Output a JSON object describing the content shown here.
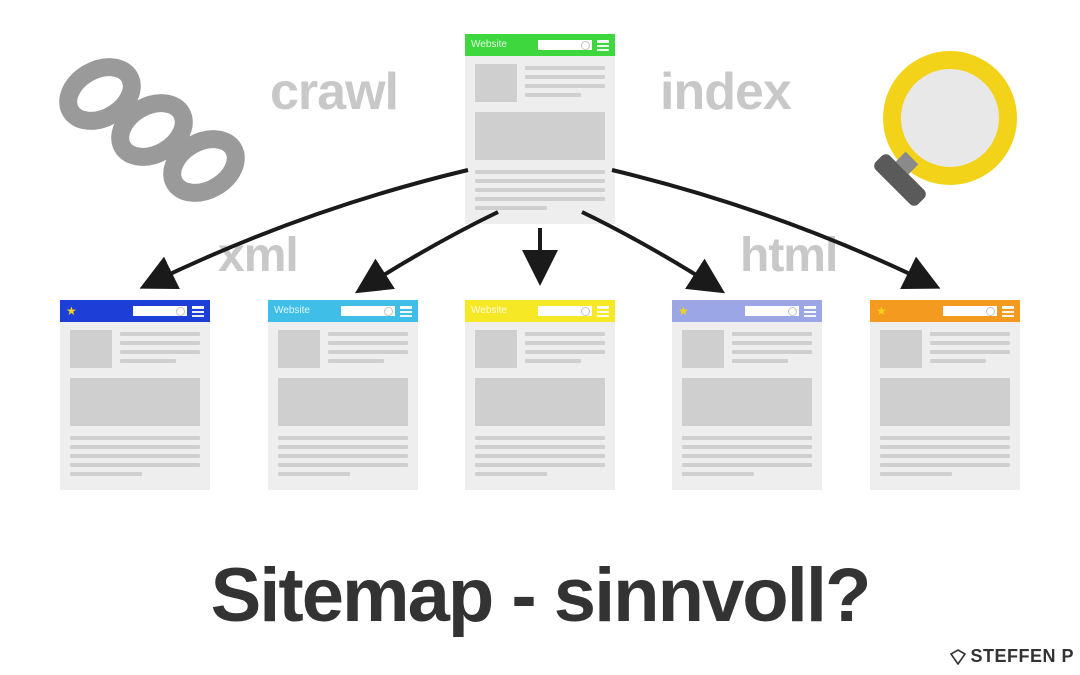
{
  "title": "Sitemap - sinnvoll?",
  "labels": {
    "crawl": "crawl",
    "index": "index",
    "xml": "xml",
    "html": "html"
  },
  "topCard": {
    "header_color": "#3ed83e",
    "label": "Website",
    "star": false
  },
  "bottomCards": [
    {
      "header_color": "#1e3ed8",
      "label": "",
      "star": true
    },
    {
      "header_color": "#3fbfe8",
      "label": "Website",
      "star": false
    },
    {
      "header_color": "#f7e826",
      "label": "Website",
      "star": false
    },
    {
      "header_color": "#9aa6e6",
      "label": "",
      "star": true
    },
    {
      "header_color": "#f39a1f",
      "label": "",
      "star": true
    }
  ],
  "brand": "STEFFEN P",
  "icons": {
    "chain": "chain-link-icon",
    "magnifier": "magnifier-icon",
    "star": "star-icon",
    "menu": "hamburger-menu-icon",
    "search": "search-icon"
  },
  "colors": {
    "label_gray": "#c8c8c8",
    "title_gray": "#333333",
    "card_bg": "#eeeeee",
    "block_gray": "#cfcfcf",
    "magnifier_yellow": "#f3d21a",
    "chain_gray": "#9a9a9a"
  }
}
